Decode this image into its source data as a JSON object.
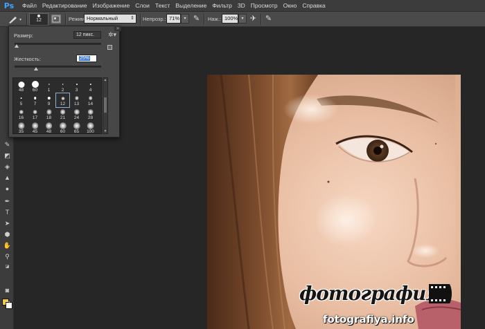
{
  "menubar": {
    "logo": "Ps",
    "items": [
      "Файл",
      "Редактирование",
      "Изображение",
      "Слои",
      "Текст",
      "Выделение",
      "Фильтр",
      "3D",
      "Просмотр",
      "Окно",
      "Справка"
    ]
  },
  "options": {
    "brush_size": "12",
    "mode_label": "Режим:",
    "mode_value": "Нормальный",
    "opacity_label": "Непрозр.:",
    "opacity_value": "71%",
    "flow_label": "Наж.:",
    "flow_value": "100%"
  },
  "brush_picker": {
    "size_label": "Размер:",
    "size_value": "12 пикс.",
    "size_fraction": 0.02,
    "hardness_label": "Жесткость:",
    "hardness_value": "25%",
    "hardness_fraction": 0.25,
    "presets": [
      {
        "label": "48",
        "hard": true,
        "r": 4.5
      },
      {
        "label": "60",
        "hard": true,
        "r": 5
      },
      {
        "label": "1",
        "hard": true,
        "r": 0.6
      },
      {
        "label": "2",
        "hard": true,
        "r": 0.8
      },
      {
        "label": "3",
        "hard": true,
        "r": 1
      },
      {
        "label": "4",
        "hard": true,
        "r": 1.2
      },
      {
        "label": "5",
        "hard": true,
        "r": 1.4
      },
      {
        "label": "7",
        "hard": true,
        "r": 1.8
      },
      {
        "label": "9",
        "hard": true,
        "r": 2.2
      },
      {
        "label": "12",
        "hard": false,
        "r": 2.5,
        "selected": true
      },
      {
        "label": "13",
        "hard": false,
        "r": 2.6
      },
      {
        "label": "14",
        "hard": false,
        "r": 2.8
      },
      {
        "label": "16",
        "hard": false,
        "r": 3.2
      },
      {
        "label": "17",
        "hard": false,
        "r": 3.4
      },
      {
        "label": "18",
        "hard": false,
        "r": 3.6
      },
      {
        "label": "21",
        "hard": false,
        "r": 3.9
      },
      {
        "label": "24",
        "hard": false,
        "r": 4.1
      },
      {
        "label": "28",
        "hard": false,
        "r": 4.3
      },
      {
        "label": "35",
        "hard": false,
        "r": 4.6
      },
      {
        "label": "45",
        "hard": false,
        "r": 4.8
      },
      {
        "label": "48",
        "hard": false,
        "r": 4.9
      },
      {
        "label": "60",
        "hard": false,
        "r": 5.1
      },
      {
        "label": "65",
        "hard": false,
        "r": 5.2
      },
      {
        "label": "100",
        "hard": false,
        "r": 5.4
      }
    ]
  },
  "watermark": {
    "script": "фотография",
    "url": "fotografiya.info"
  },
  "colors": {
    "foreground": "#f5c842",
    "background": "#ffffff",
    "accent": "#3ea6ff"
  }
}
